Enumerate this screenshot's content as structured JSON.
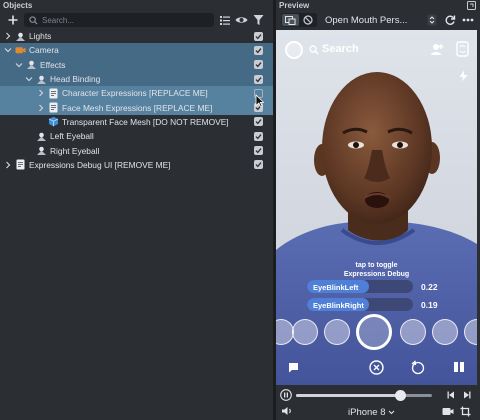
{
  "objects_panel": {
    "title": "Objects",
    "search_placeholder": "Search...",
    "tree": [
      {
        "label": "Lights",
        "checked": true
      },
      {
        "label": "Camera",
        "checked": true
      },
      {
        "label": "Effects",
        "checked": true
      },
      {
        "label": "Head Binding",
        "checked": true
      },
      {
        "label": "Character Expressions [REPLACE ME]",
        "checked": false
      },
      {
        "label": "Face Mesh Expressions [REPLACE ME]",
        "checked": true
      },
      {
        "label": "Transparent Face Mesh [DO NOT REMOVE]",
        "checked": true
      },
      {
        "label": "Left Eyeball",
        "checked": true
      },
      {
        "label": "Right Eyeball",
        "checked": true
      },
      {
        "label": "Expressions Debug UI [REMOVE ME]",
        "checked": true
      }
    ]
  },
  "preview_panel": {
    "title": "Preview",
    "lens_name": "Open Mouth Pers...",
    "search_label": "Search",
    "tap_hint_line1": "tap to toggle",
    "tap_hint_line2": "Expressions Debug",
    "metrics": [
      {
        "name": "EyeBlinkLeft",
        "value": "0.22",
        "level": 0.22
      },
      {
        "name": "EyeBlinkRight",
        "value": "0.19",
        "level": 0.19
      }
    ],
    "playback_progress": 0.77,
    "device": "iPhone 8"
  },
  "colors": {
    "panel_bg": "#2b2e33",
    "selection": "#456a85",
    "selection_hover": "#56819f",
    "accent_blue": "#4a7fd8",
    "shirt_blue": "#5566a8"
  }
}
